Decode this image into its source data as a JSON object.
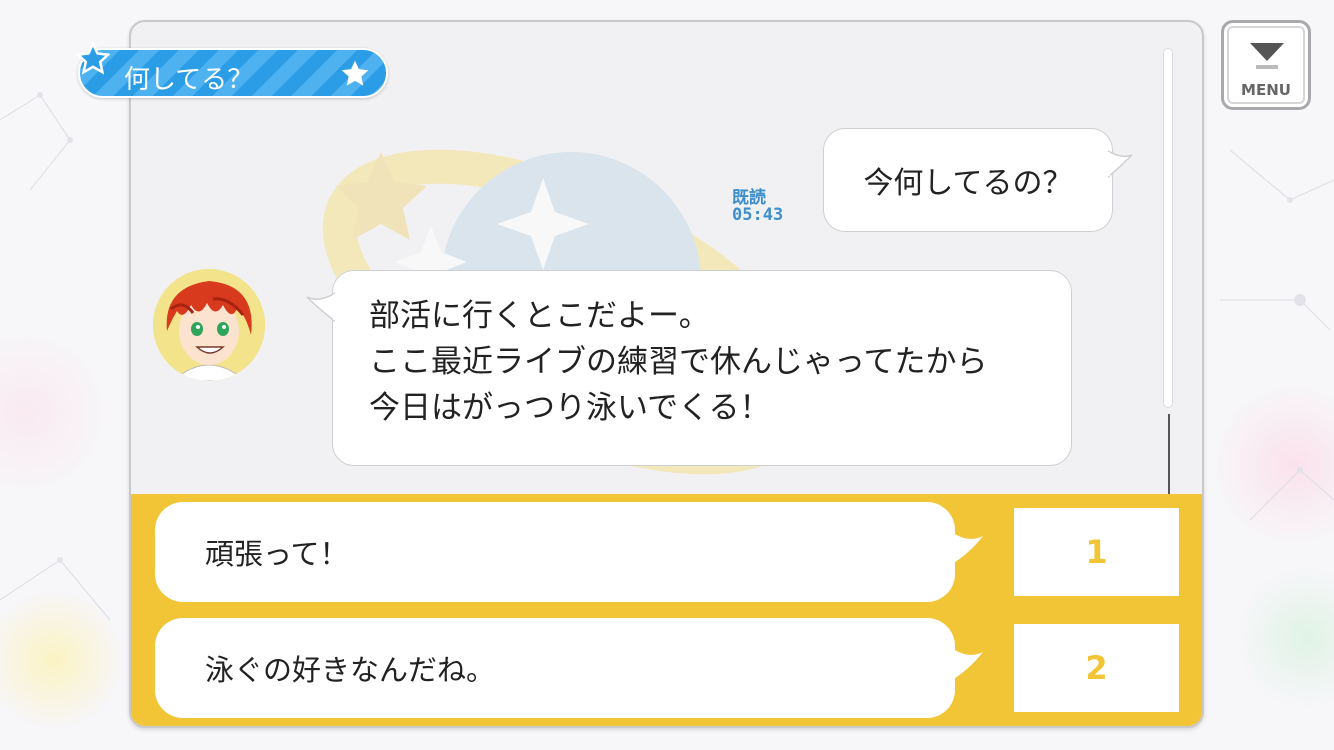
{
  "header": {
    "title": "何してる？",
    "title_icon_left": "star-icon",
    "title_icon_right": "star-icon"
  },
  "menu": {
    "label": "MENU",
    "icon": "chevron-down-icon"
  },
  "chat": {
    "sent_message": "今何してるの？",
    "read_label": "既読",
    "read_time": "05:43",
    "received_lines": [
      "部活に行くとこだよー。",
      "ここ最近ライブの練習で休んじゃってたから",
      "今日はがっつり泳いでくる！"
    ]
  },
  "choices": [
    {
      "text": "頑張って！",
      "number": "1"
    },
    {
      "text": "泳ぐの好きなんだね。",
      "number": "2"
    }
  ],
  "colors": {
    "accent_yellow": "#f1c535",
    "tag_blue": "#2b9ce6",
    "read_blue": "#3c8fca"
  }
}
